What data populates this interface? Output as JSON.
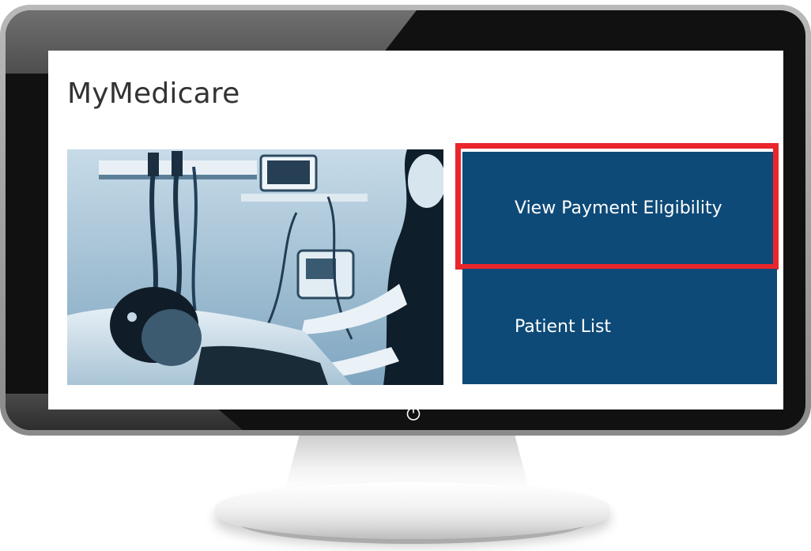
{
  "app": {
    "title": "MyMedicare"
  },
  "hero": {
    "image_description": "Nurse attending to a patient lying in a hospital bed, blue-tinted photo"
  },
  "tiles": [
    {
      "label": "View Payment Eligibility",
      "highlighted": true
    },
    {
      "label": "Patient List",
      "highlighted": false
    }
  ],
  "colors": {
    "tile_background": "#0e4a78",
    "tile_text": "#ffffff",
    "highlight_border": "#e8262c",
    "title_text": "#333333",
    "bezel": "#111111"
  },
  "icons": {
    "power": "power-icon"
  }
}
